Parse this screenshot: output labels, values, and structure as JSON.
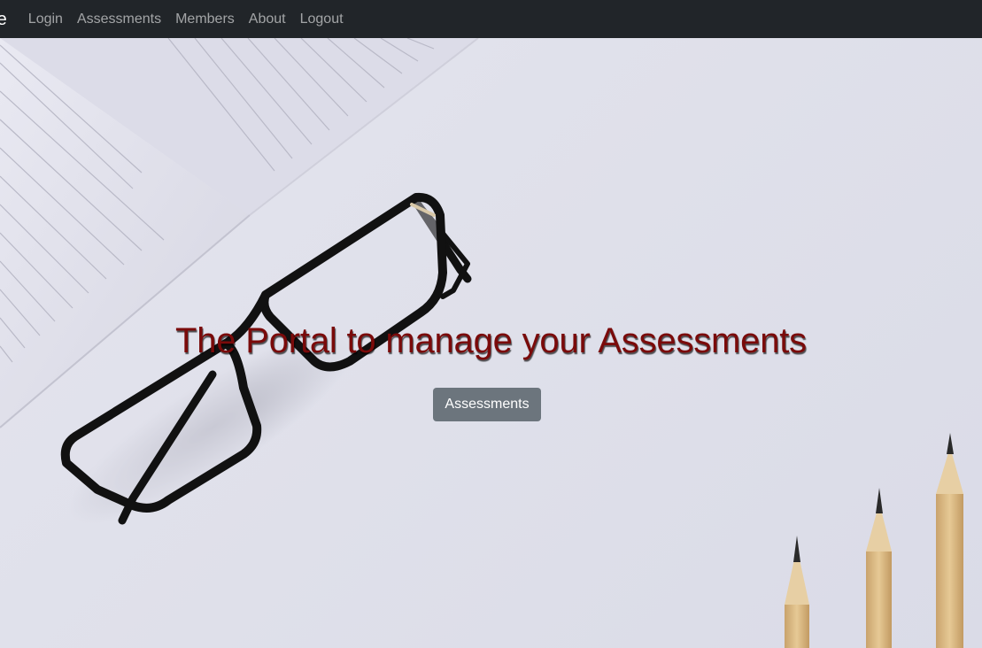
{
  "navbar": {
    "brand": "me",
    "links": [
      "Login",
      "Assessments",
      "Members",
      "About",
      "Logout"
    ]
  },
  "hero": {
    "title": "The Portal to manage your Assessments",
    "button_label": "Assessments"
  },
  "colors": {
    "navbar_bg": "#212529",
    "title": "#7a0a0a",
    "button_bg": "#6c757d"
  }
}
